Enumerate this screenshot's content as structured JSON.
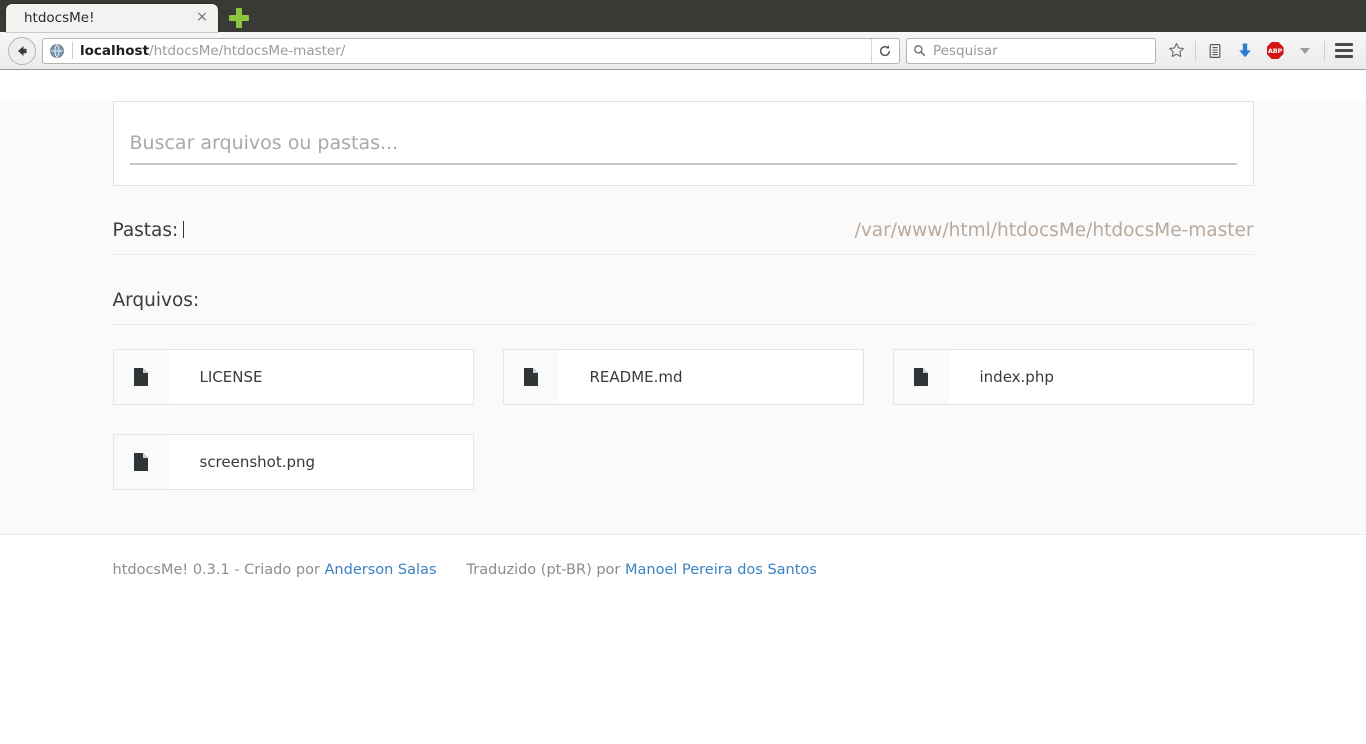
{
  "browser": {
    "tab": {
      "title": "htdocsMe!",
      "close_label": "×"
    },
    "newtab_label": "new-tab",
    "url": {
      "host": "localhost",
      "path": "/htdocsMe/htdocsMe-master/"
    },
    "search": {
      "placeholder": "Pesquisar",
      "value": ""
    },
    "reload_label": "↻",
    "abp_label": "ABP",
    "icons": {
      "back": "back-arrow-icon",
      "globe": "globe-icon",
      "reload": "reload-icon",
      "search": "search-icon",
      "bookmark": "star-icon",
      "library": "library-icon",
      "downloads": "download-arrow-icon",
      "adblock": "adblock-plus-icon",
      "caret": "chevron-down-icon",
      "menu": "hamburger-menu-icon"
    },
    "colors": {
      "download_blue": "#2a7fd4",
      "adblock_red": "#d31414",
      "newtab_green": "#8cc63e"
    }
  },
  "page": {
    "search": {
      "placeholder": "Buscar arquivos ou pastas...",
      "value": ""
    },
    "folders": {
      "label": "Pastas:",
      "path": "/var/www/html/htdocsMe/htdocsMe-master"
    },
    "files": {
      "label": "Arquivos:",
      "items": [
        {
          "name": "LICENSE",
          "icon": "file-icon"
        },
        {
          "name": "README.md",
          "icon": "file-icon"
        },
        {
          "name": "index.php",
          "icon": "file-icon"
        },
        {
          "name": "screenshot.png",
          "icon": "file-icon"
        }
      ]
    },
    "footer": {
      "credit_prefix": "htdocsMe! 0.3.1 - Criado por",
      "author": "Anderson Salas",
      "translation_prefix": "Traduzido (pt-BR) por",
      "translator": "Manoel Pereira dos Santos",
      "link_color": "#3b82c4"
    }
  }
}
